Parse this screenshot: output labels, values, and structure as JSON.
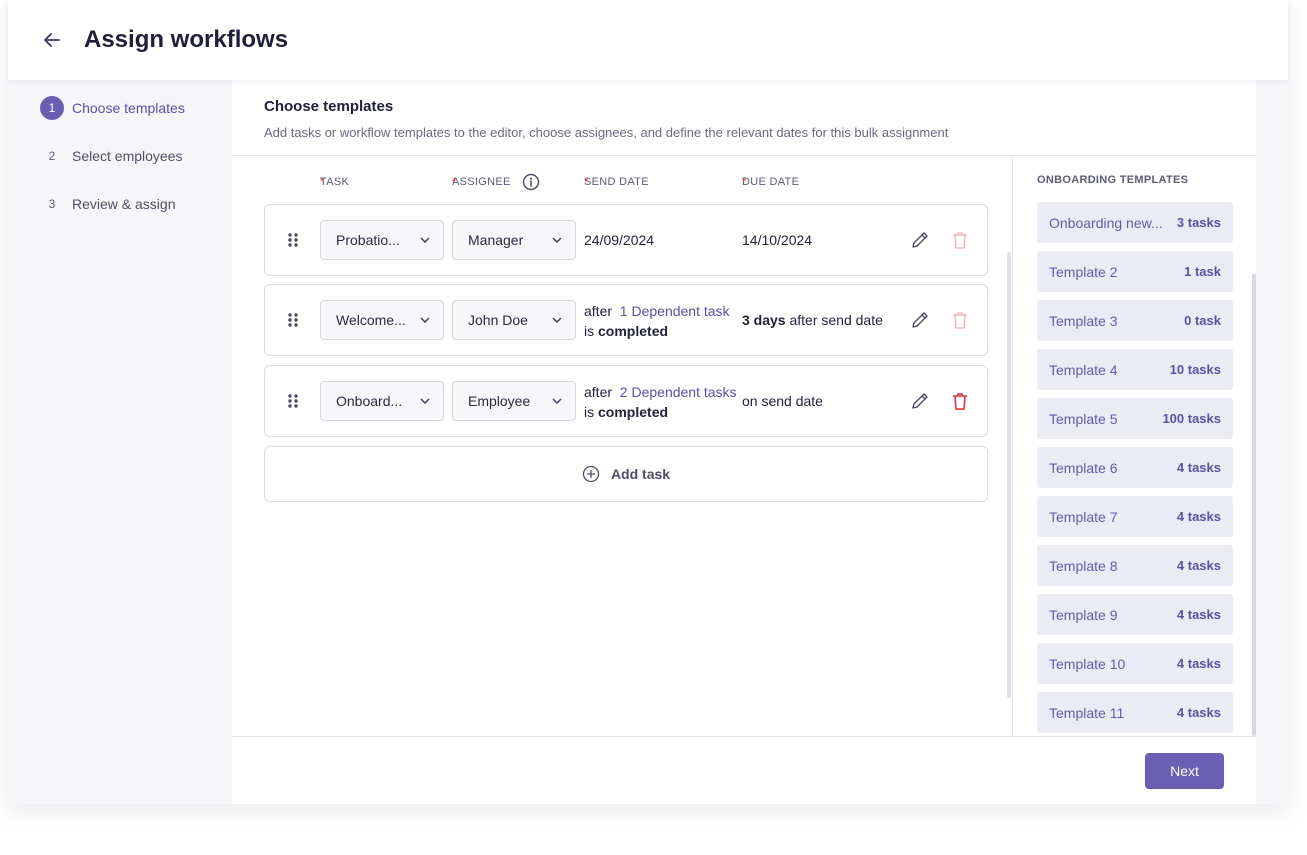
{
  "header": {
    "title": "Assign workflows",
    "back_icon": "arrow-left-icon"
  },
  "steps": [
    {
      "num": "1",
      "label": "Choose templates",
      "active": true
    },
    {
      "num": "2",
      "label": "Select employees",
      "active": false
    },
    {
      "num": "3",
      "label": "Review & assign",
      "active": false
    }
  ],
  "panel": {
    "title": "Choose templates",
    "subtitle": "Add tasks or workflow templates to the editor, choose assignees, and define the relevant dates for this bulk assignment"
  },
  "columns": {
    "task": "TASK",
    "assignee": "ASSIGNEE",
    "send_date": "SEND DATE",
    "due_date": "DUE DATE",
    "required_mark": "*"
  },
  "rows": [
    {
      "task": "Probatio...",
      "assignee": "Manager",
      "send_date": "24/09/2024",
      "due_date": "14/10/2024",
      "delete_enabled": false
    },
    {
      "task": "Welcome...",
      "assignee": "John Doe",
      "send_prefix": "after",
      "send_link": "1 Dependent task",
      "send_is": "is",
      "send_completed": "completed",
      "due_bold": "3 days",
      "due_rest": "after send date",
      "delete_enabled": false
    },
    {
      "task": "Onboard...",
      "assignee": "Employee",
      "send_prefix": "after",
      "send_link": "2 Dependent tasks",
      "send_is": "is",
      "send_completed": "completed",
      "due_text": "on send date",
      "delete_enabled": true
    }
  ],
  "add_task": {
    "label": "Add task"
  },
  "templates": {
    "heading": "ONBOARDING TEMPLATES",
    "items": [
      {
        "name": "Onboarding new...",
        "count": "3 tasks"
      },
      {
        "name": "Template 2",
        "count": "1 task"
      },
      {
        "name": "Template 3",
        "count": "0 task"
      },
      {
        "name": "Template 4",
        "count": "10 tasks"
      },
      {
        "name": "Template 5",
        "count": "100 tasks"
      },
      {
        "name": "Template 6",
        "count": "4 tasks"
      },
      {
        "name": "Template 7",
        "count": "4 tasks"
      },
      {
        "name": "Template 8",
        "count": "4 tasks"
      },
      {
        "name": "Template 9",
        "count": "4 tasks"
      },
      {
        "name": "Template 10",
        "count": "4 tasks"
      },
      {
        "name": "Template 11",
        "count": "4 tasks"
      }
    ]
  },
  "footer": {
    "next_label": "Next"
  },
  "colors": {
    "accent": "#6a5fb3",
    "danger": "#e0454f",
    "danger_disabled": "#f2b8bc",
    "link": "#5a50a8"
  }
}
